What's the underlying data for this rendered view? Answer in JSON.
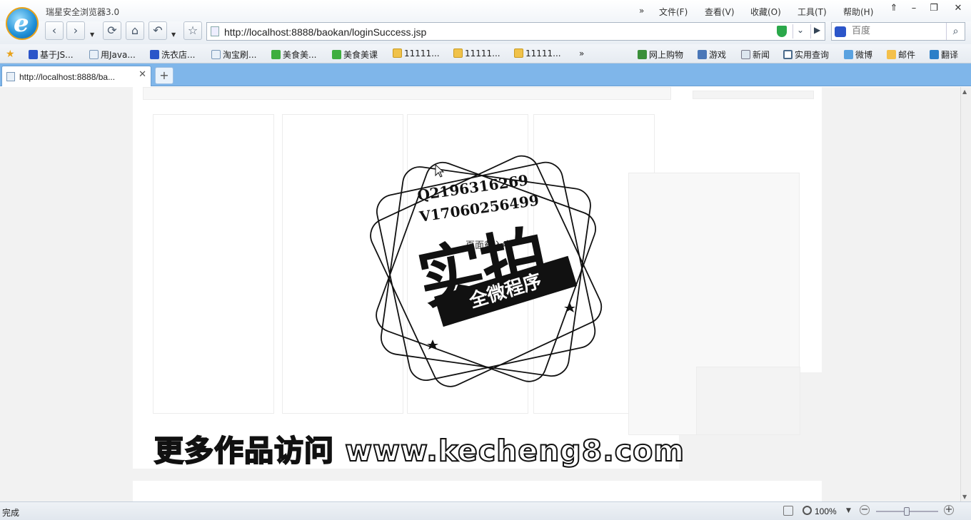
{
  "window": {
    "title": "瑞星安全浏览器3.0",
    "menu": [
      "»",
      "文件(F)",
      "查看(V)",
      "收藏(O)",
      "工具(T)",
      "帮助(H)"
    ]
  },
  "navbar": {
    "url": "http://localhost:8888/baokan/loginSuccess.jsp",
    "search_placeholder": "百度"
  },
  "favorites": {
    "items": [
      {
        "label": "基于JS...",
        "icon": "paw-icon"
      },
      {
        "label": "用Java...",
        "icon": "page-icon"
      },
      {
        "label": "洗衣店...",
        "icon": "paw-icon"
      },
      {
        "label": "淘宝刷...",
        "icon": "page-icon"
      },
      {
        "label": "美食美...",
        "icon": "iqiyi-icon"
      },
      {
        "label": "美食美课",
        "icon": "iqiyi-icon"
      },
      {
        "label": "11111...",
        "icon": "folder-icon"
      },
      {
        "label": "11111...",
        "icon": "folder-icon"
      },
      {
        "label": "11111...",
        "icon": "folder-icon"
      }
    ],
    "more": "»",
    "right_items": [
      {
        "label": "网上购物",
        "icon": "cart-icon"
      },
      {
        "label": "游戏",
        "icon": "game-icon"
      },
      {
        "label": "新闻",
        "icon": "news-icon"
      },
      {
        "label": "实用查询",
        "icon": "query-icon"
      },
      {
        "label": "微博",
        "icon": "weibo-icon"
      },
      {
        "label": "邮件",
        "icon": "mail-icon"
      },
      {
        "label": "翻译",
        "icon": "translate-icon"
      }
    ]
  },
  "tabs": {
    "active_label": "http://localhost:8888/ba...",
    "new_tab": "+"
  },
  "content": {
    "loading_text": "页面载入中",
    "watermark": {
      "qq": "Q2196316269",
      "wx": "V17060256499",
      "big": "实拍",
      "ribbon": "全微程序",
      "banner": "更多作品访问 www.kecheng8.com"
    }
  },
  "statusbar": {
    "status": "完成",
    "zoom": "100%",
    "zoom_level_percent": 100
  },
  "colors": {
    "tabbar": "#7fb6ea",
    "content_bg": "#f2f2f2"
  }
}
